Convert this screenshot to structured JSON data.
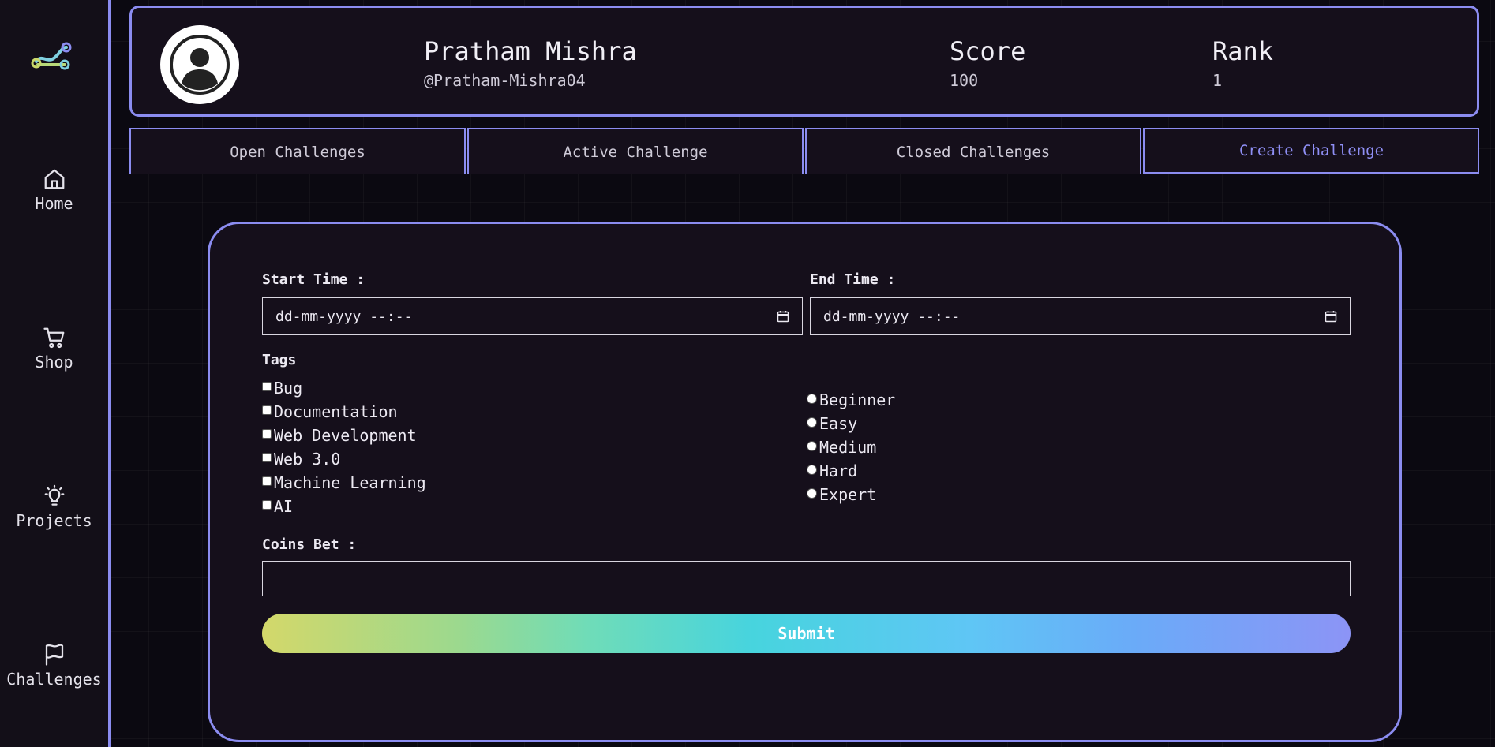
{
  "sidebar": {
    "items": [
      {
        "label": "Home",
        "icon": "home-icon"
      },
      {
        "label": "Shop",
        "icon": "cart-icon"
      },
      {
        "label": "Projects",
        "icon": "lightbulb-icon"
      },
      {
        "label": "Challenges",
        "icon": "flag-icon"
      }
    ]
  },
  "profile": {
    "name": "Pratham Mishra",
    "handle": "@Pratham-Mishra04",
    "score_label": "Score",
    "score_value": "100",
    "rank_label": "Rank",
    "rank_value": "1"
  },
  "tabs": [
    {
      "label": "Open Challenges"
    },
    {
      "label": "Active Challenge"
    },
    {
      "label": "Closed Challenges"
    },
    {
      "label": "Create Challenge",
      "active": true
    }
  ],
  "form": {
    "start_time_label": "Start Time :",
    "start_time_value": "dd-mm-yyyy --:--",
    "end_time_label": "End Time :",
    "end_time_value": "dd-mm-yyyy --:--",
    "tags_label": "Tags",
    "tags": [
      "Bug",
      "Documentation",
      "Web Development",
      "Web 3.0",
      "Machine Learning",
      "AI"
    ],
    "difficulties": [
      "Beginner",
      "Easy",
      "Medium",
      "Hard",
      "Expert"
    ],
    "coins_label": "Coins Bet :",
    "coins_value": "",
    "submit_label": "Submit"
  },
  "colors": {
    "accent": "#8b8cf0",
    "panel": "#150f1b",
    "background": "#0c0a12"
  }
}
